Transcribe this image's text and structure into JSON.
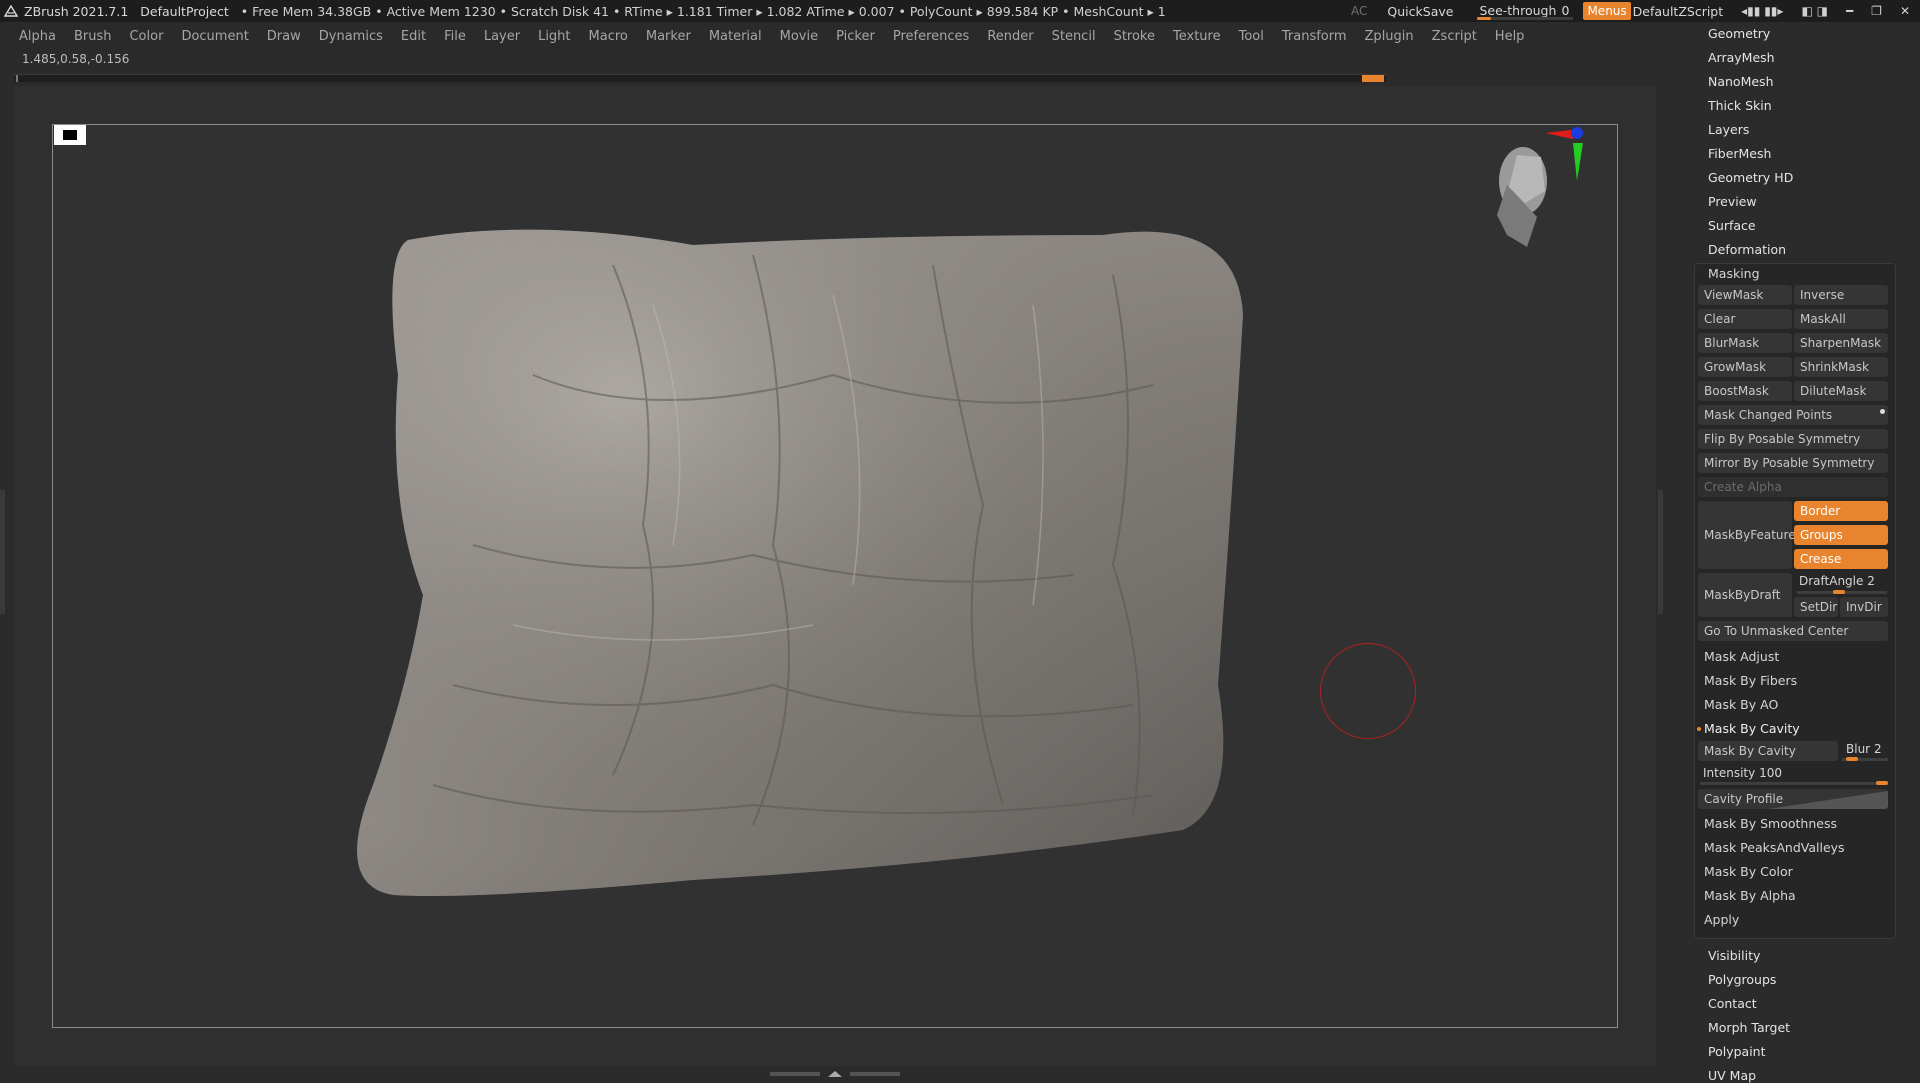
{
  "top_bar": {
    "app": "ZBrush 2021.7.1",
    "project": "DefaultProject",
    "stats": "• Free Mem 34.38GB • Active Mem 1230 • Scratch Disk 41 • RTime ▸ 1.181 Timer ▸ 1.082 ATime ▸ 0.007 • PolyCount ▸ 899.584 KP • MeshCount ▸ 1",
    "ac": "AC",
    "quicksave": "QuickSave",
    "see_through_label": "See-through",
    "see_through_value": "0",
    "menus": "Menus",
    "script": "DefaultZScript"
  },
  "menu_bar": [
    "Alpha",
    "Brush",
    "Color",
    "Document",
    "Draw",
    "Dynamics",
    "Edit",
    "File",
    "Layer",
    "Light",
    "Macro",
    "Marker",
    "Material",
    "Movie",
    "Picker",
    "Preferences",
    "Render",
    "Stencil",
    "Stroke",
    "Texture",
    "Tool",
    "Transform",
    "Zplugin",
    "Zscript",
    "Help"
  ],
  "coords": "1.485,0.58,-0.156",
  "right_panel": {
    "top_items": [
      "Geometry",
      "ArrayMesh",
      "NanoMesh",
      "Thick Skin",
      "Layers",
      "FiberMesh",
      "Geometry HD",
      "Preview",
      "Surface",
      "Deformation"
    ],
    "masking": {
      "title": "Masking",
      "view_mask": "ViewMask",
      "inverse": "Inverse",
      "clear": "Clear",
      "mask_all": "MaskAll",
      "blur_mask": "BlurMask",
      "sharpen_mask": "SharpenMask",
      "grow_mask": "GrowMask",
      "shrink_mask": "ShrinkMask",
      "boost_mask": "BoostMask",
      "dilute_mask": "DiluteMask",
      "mask_changed_points": "Mask Changed Points",
      "flip_by_posable": "Flip By Posable Symmetry",
      "mirror_by_posable": "Mirror By Posable Symmetry",
      "create_alpha": "Create Alpha",
      "mask_by_feature": "MaskByFeature",
      "border": "Border",
      "groups": "Groups",
      "crease": "Crease",
      "mask_by_draft": "MaskByDraft",
      "draft_angle_label": "DraftAngle",
      "draft_angle_value": "2",
      "set_dir": "SetDir",
      "inv_dir": "InvDir",
      "go_to_unmasked": "Go To Unmasked Center",
      "mask_adjust": "Mask Adjust",
      "mask_by_fibers": "Mask By Fibers",
      "mask_by_ao": "Mask By AO",
      "mask_by_cavity_header": "Mask By Cavity",
      "mask_by_cavity_btn": "Mask By Cavity",
      "blur_label": "Blur",
      "blur_value": "2",
      "intensity_label": "Intensity",
      "intensity_value": "100",
      "cavity_profile": "Cavity Profile",
      "mask_by_smoothness": "Mask By Smoothness",
      "mask_peaks_valleys": "Mask PeaksAndValleys",
      "mask_by_color": "Mask By Color",
      "mask_by_alpha": "Mask By Alpha",
      "apply": "Apply"
    },
    "bottom_items": [
      "Visibility",
      "Polygroups",
      "Contact",
      "Morph Target",
      "Polypaint",
      "UV Map"
    ]
  }
}
